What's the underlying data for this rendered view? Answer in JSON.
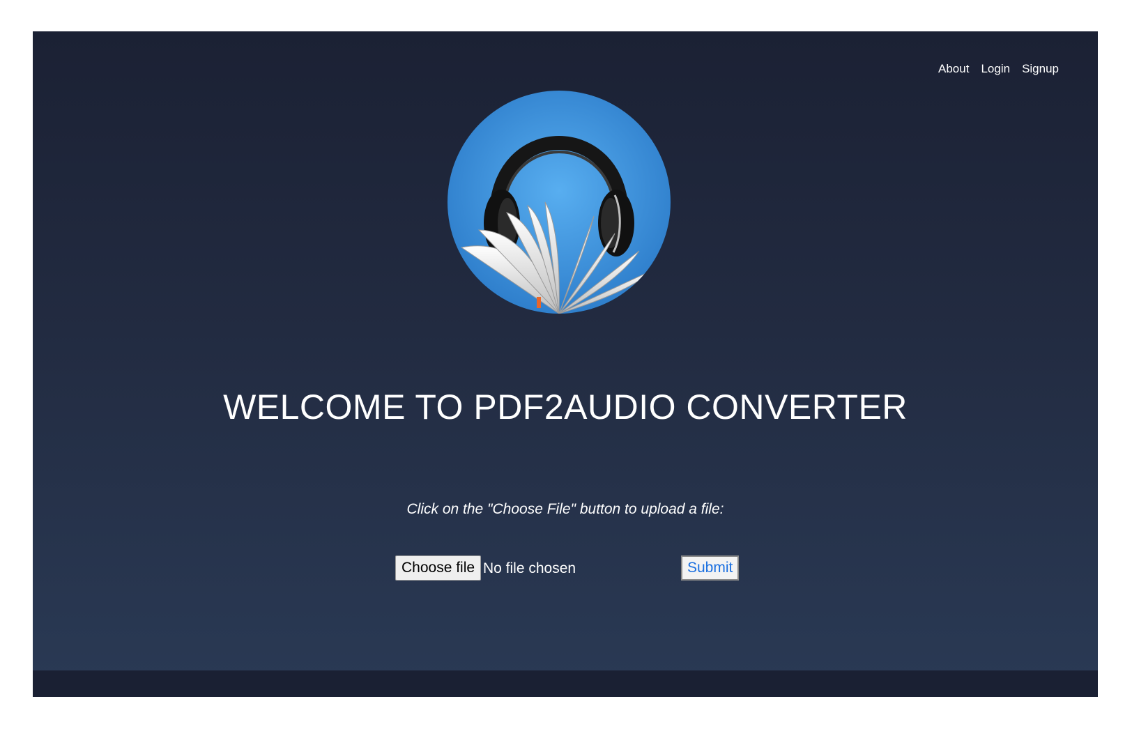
{
  "nav": {
    "items": [
      {
        "label": "About"
      },
      {
        "label": "Login"
      },
      {
        "label": "Signup"
      }
    ]
  },
  "logo": {
    "icon": "headphones-book-icon",
    "colors": {
      "circle": "#3a8fd9",
      "headphones": "#1a1a1a",
      "pages": "#f0f0f0",
      "bookmark": "#e8662a"
    }
  },
  "main": {
    "title": "WELCOME TO PDF2AUDIO CONVERTER",
    "instruction": "Click on the \"Choose File\" button to upload a file:",
    "choose_label": "Choose file",
    "file_status": "No file chosen",
    "submit_label": "Submit"
  },
  "colors": {
    "background_top": "#1b2134",
    "background_bottom": "#2a3a55",
    "footer": "#1a2033",
    "submit_text": "#1a6fe0"
  }
}
